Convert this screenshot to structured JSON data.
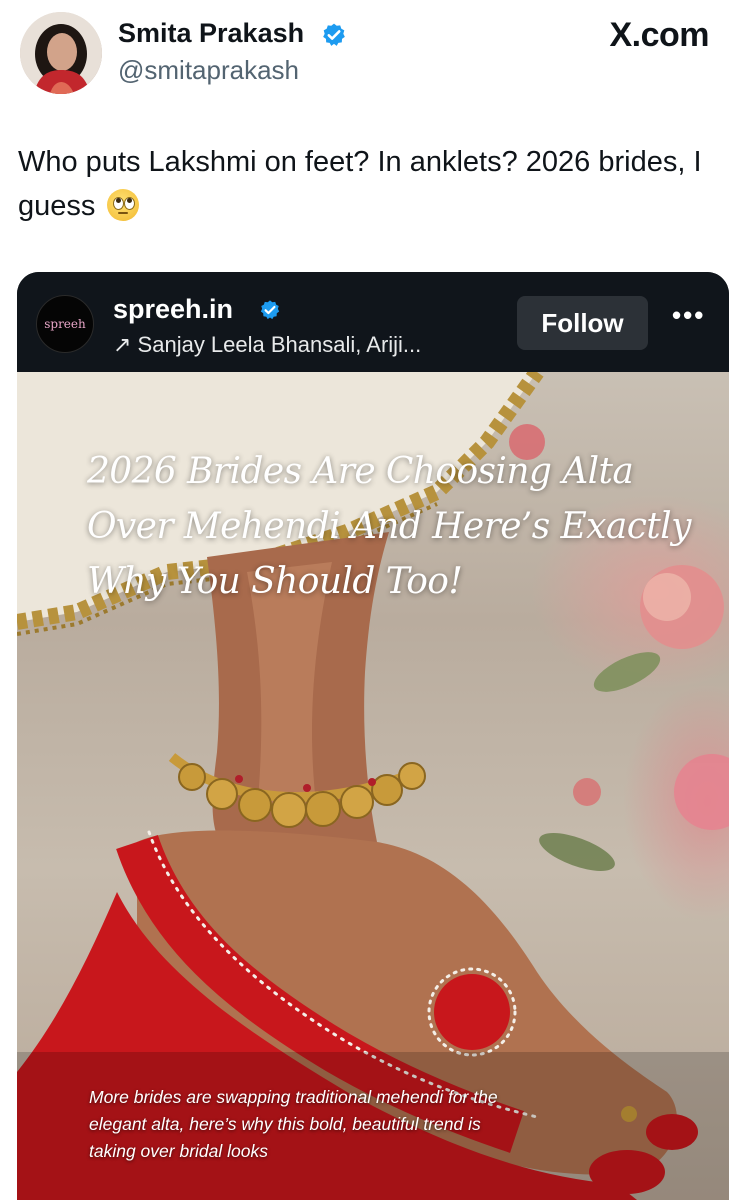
{
  "author": {
    "name": "Smita Prakash",
    "handle": "@smitaprakash"
  },
  "site_label": "X.com",
  "tweet": {
    "text": "Who puts Lakshmi on feet? In anklets? 2026 brides, I guess",
    "emoji": "face-with-rolling-eyes"
  },
  "embedded_post": {
    "account_name": "spreeh.in",
    "logo_text": "spreeh",
    "audio_line": "↗ Sanjay Leela Bhansali, Ariji...",
    "follow_label": "Follow",
    "more_label": "•••",
    "image": {
      "headline": "2026 Brides Are Choosing Alta Over Mehendi And Here’s Exactly Why You Should Too!",
      "caption": "More brides are swapping traditional mehendi for the elegant alta, here’s why this bold, beautiful trend is taking over bridal looks"
    }
  },
  "colors": {
    "verified_blue": "#1d9bf0",
    "alta_red": "#c8171c",
    "gold": "#c89a3a"
  }
}
